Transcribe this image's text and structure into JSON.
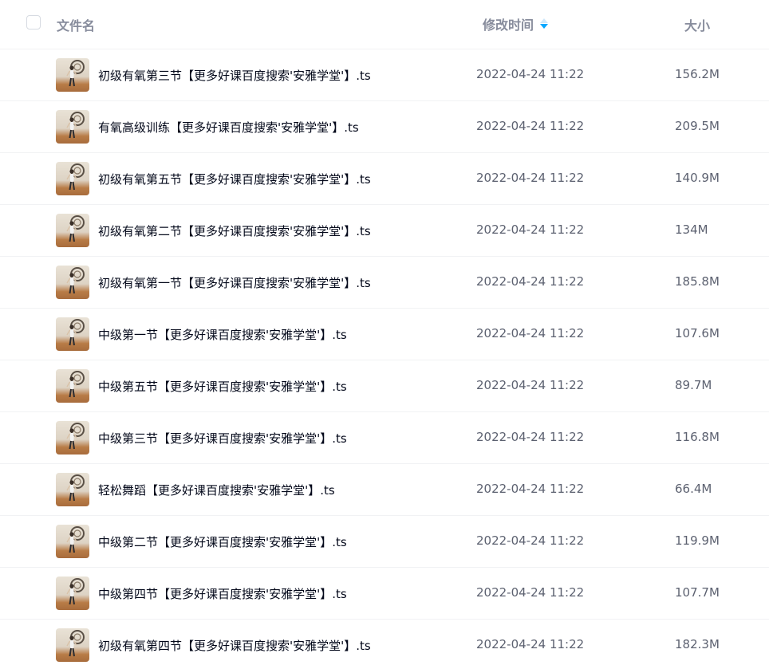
{
  "header": {
    "name_label": "文件名",
    "time_label": "修改时间",
    "size_label": "大小",
    "sort_icon": "sort-desc-icon",
    "accent_color": "#06a7ff"
  },
  "files": [
    {
      "name": "初级有氧第三节【更多好课百度搜索'安雅学堂'】.ts",
      "time": "2022-04-24 11:22",
      "size": "156.2M",
      "icon": "video-thumbnail"
    },
    {
      "name": "有氧高级训练【更多好课百度搜索'安雅学堂'】.ts",
      "time": "2022-04-24 11:22",
      "size": "209.5M",
      "icon": "video-thumbnail"
    },
    {
      "name": "初级有氧第五节【更多好课百度搜索'安雅学堂'】.ts",
      "time": "2022-04-24 11:22",
      "size": "140.9M",
      "icon": "video-thumbnail"
    },
    {
      "name": "初级有氧第二节【更多好课百度搜索'安雅学堂'】.ts",
      "time": "2022-04-24 11:22",
      "size": "134M",
      "icon": "video-thumbnail"
    },
    {
      "name": "初级有氧第一节【更多好课百度搜索'安雅学堂'】.ts",
      "time": "2022-04-24 11:22",
      "size": "185.8M",
      "icon": "video-thumbnail"
    },
    {
      "name": "中级第一节【更多好课百度搜索'安雅学堂'】.ts",
      "time": "2022-04-24 11:22",
      "size": "107.6M",
      "icon": "video-thumbnail"
    },
    {
      "name": "中级第五节【更多好课百度搜索'安雅学堂'】.ts",
      "time": "2022-04-24 11:22",
      "size": "89.7M",
      "icon": "video-thumbnail"
    },
    {
      "name": "中级第三节【更多好课百度搜索'安雅学堂'】.ts",
      "time": "2022-04-24 11:22",
      "size": "116.8M",
      "icon": "video-thumbnail"
    },
    {
      "name": "轻松舞蹈【更多好课百度搜索'安雅学堂'】.ts",
      "time": "2022-04-24 11:22",
      "size": "66.4M",
      "icon": "video-thumbnail"
    },
    {
      "name": "中级第二节【更多好课百度搜索'安雅学堂'】.ts",
      "time": "2022-04-24 11:22",
      "size": "119.9M",
      "icon": "video-thumbnail"
    },
    {
      "name": "中级第四节【更多好课百度搜索'安雅学堂'】.ts",
      "time": "2022-04-24 11:22",
      "size": "107.7M",
      "icon": "video-thumbnail"
    },
    {
      "name": "初级有氧第四节【更多好课百度搜索'安雅学堂'】.ts",
      "time": "2022-04-24 11:22",
      "size": "182.3M",
      "icon": "video-thumbnail"
    }
  ]
}
